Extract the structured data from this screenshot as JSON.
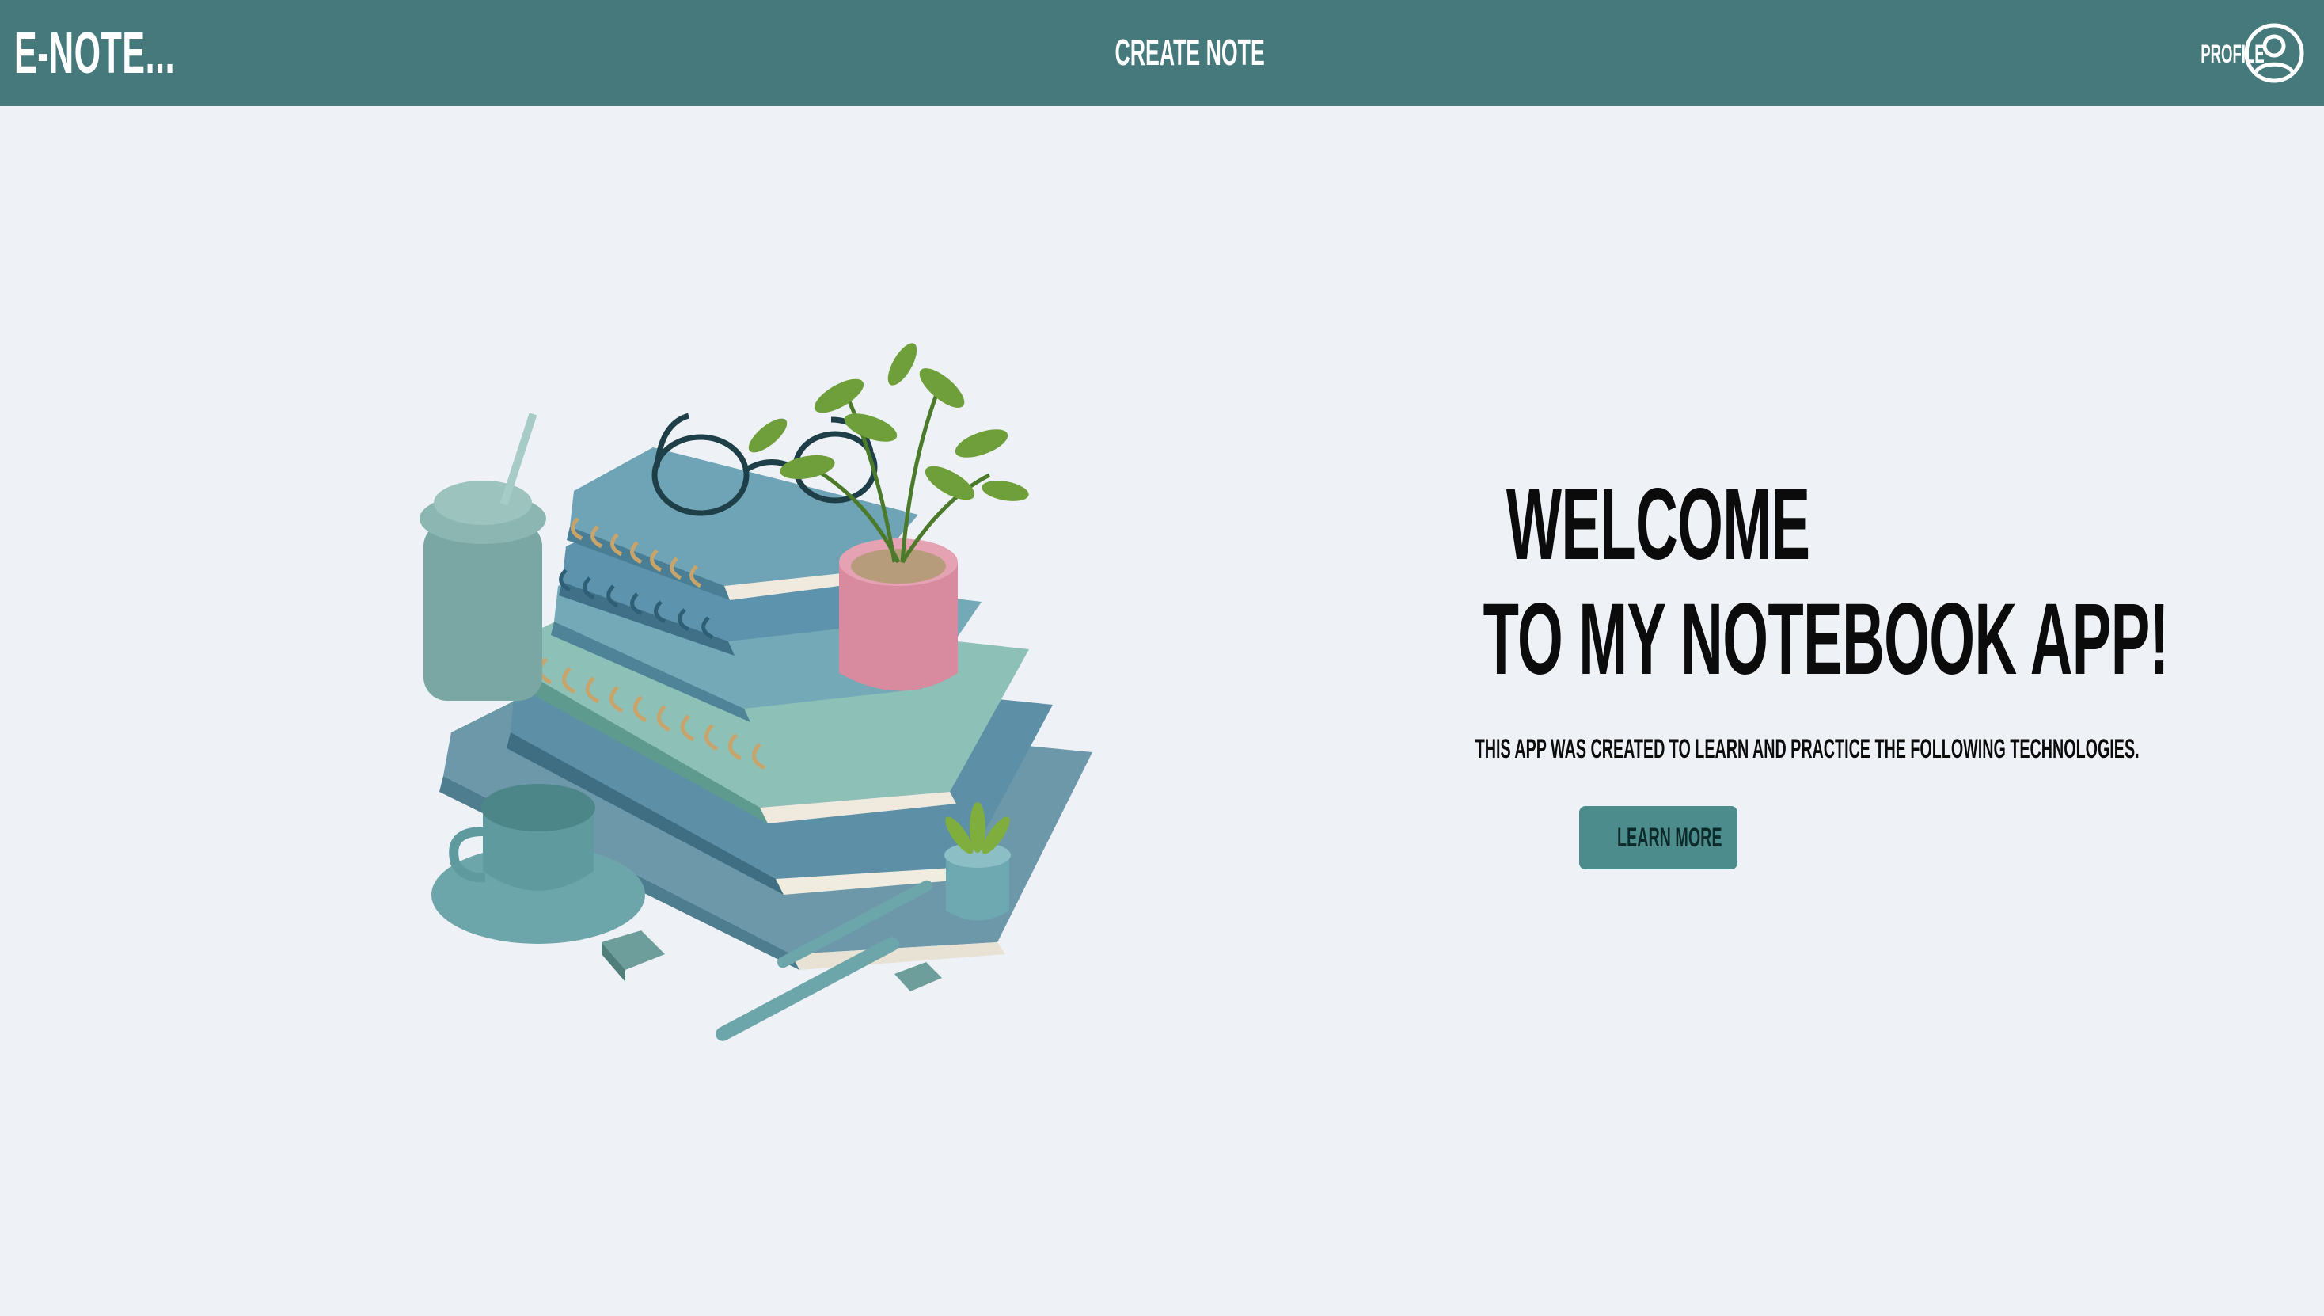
{
  "navbar": {
    "brand": "E-NOTE...",
    "create_note": "CREATE NOTE",
    "profile_label": "PROFILE",
    "profile_icon": "user-circle-icon"
  },
  "hero": {
    "title_line1": "WELCOME",
    "title_line2": "TO MY NOTEBOOK APP!",
    "subtitle": "THIS APP WAS CREATED TO LEARN AND PRACTICE THE FOLLOWING TECHNOLOGIES.",
    "button_label": "LEARN MORE"
  },
  "colors": {
    "navbar_bg": "#45797b",
    "page_bg": "#eef1f6",
    "button_bg": "#4d8c8c",
    "text_dark": "#0b0b0b"
  }
}
